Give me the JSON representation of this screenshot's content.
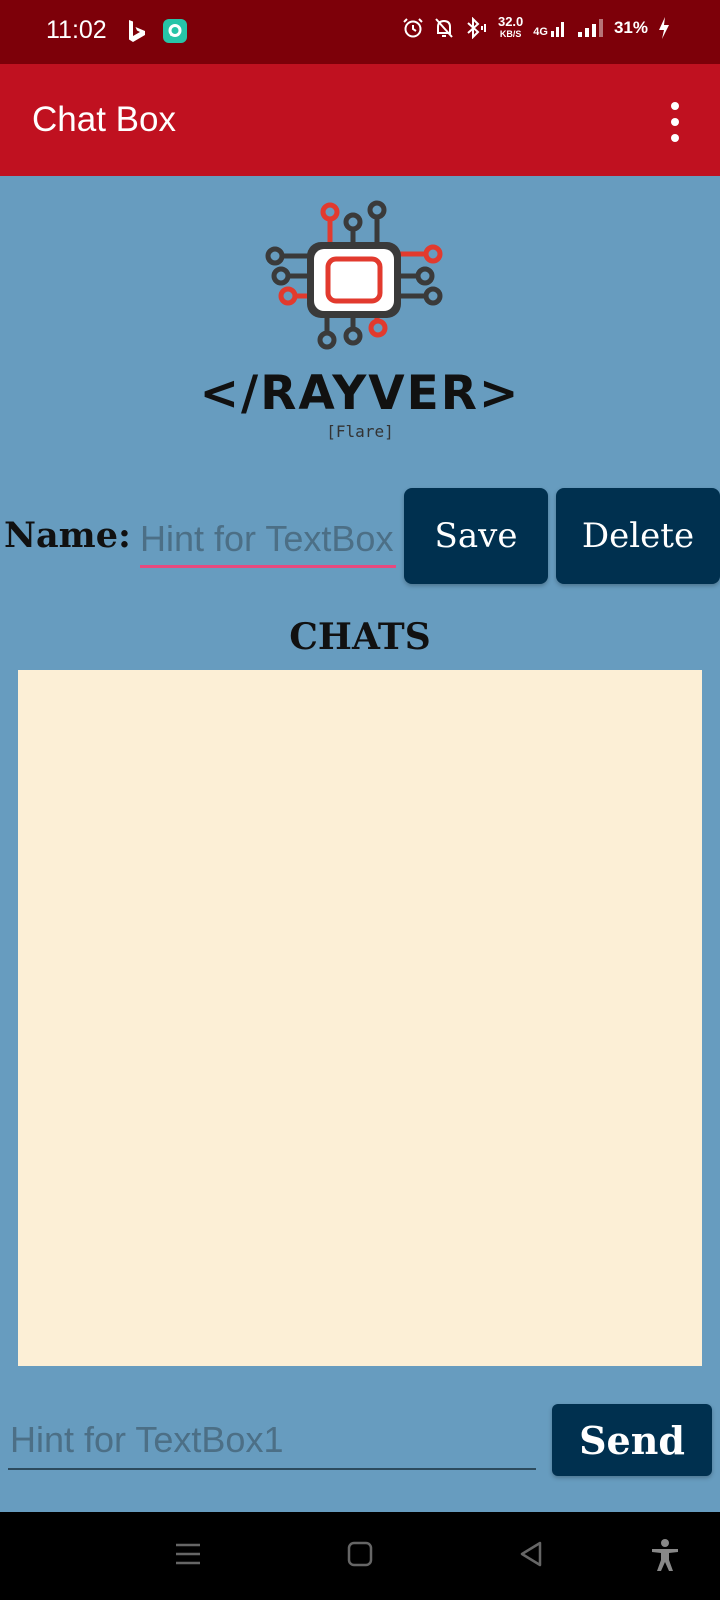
{
  "status_bar": {
    "time": "11:02",
    "speed_value": "32.0",
    "speed_unit": "KB/S",
    "network": "4G",
    "battery": "31%"
  },
  "app_bar": {
    "title": "Chat Box"
  },
  "logo": {
    "text": "</RAYVER>",
    "subtitle": "[Flare]"
  },
  "name_row": {
    "label": "Name:",
    "placeholder": "Hint for TextBox",
    "save_label": "Save",
    "delete_label": "Delete"
  },
  "chats": {
    "title": "CHATS"
  },
  "message_row": {
    "placeholder": "Hint for TextBox1",
    "send_label": "Send"
  },
  "colors": {
    "status_bar": "#7d0009",
    "app_bar": "#c01120",
    "background": "#679cbf",
    "button": "#00304f",
    "chat_area": "#fcefd6",
    "input_underline": "#e8497e"
  }
}
